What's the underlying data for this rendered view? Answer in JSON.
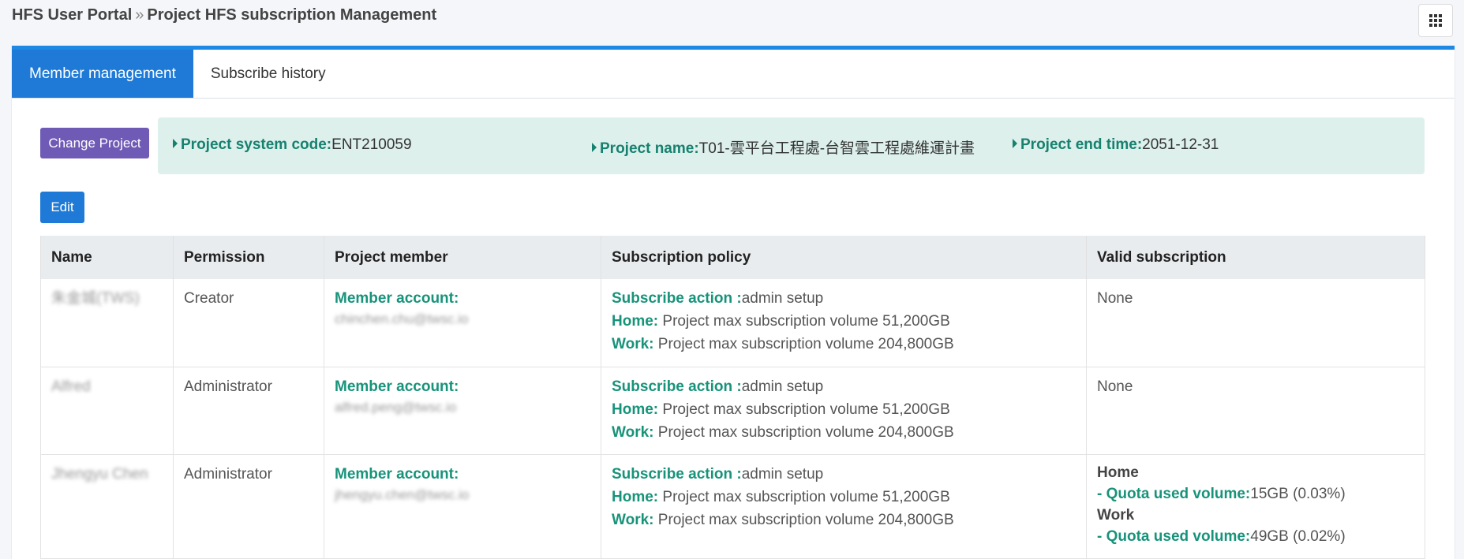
{
  "breadcrumb": {
    "root": "HFS User Portal",
    "separator": "»",
    "current": "Project HFS subscription Management"
  },
  "apps_icon": "apps-grid-icon",
  "tabs": [
    {
      "label": "Member management",
      "active": true
    },
    {
      "label": "Subscribe history",
      "active": false
    }
  ],
  "buttons": {
    "change_project": "Change Project",
    "edit": "Edit"
  },
  "project_info": {
    "code_label": "Project system code:",
    "code_value": "ENT210059",
    "name_label": "Project name:",
    "name_value": "T01-雲平台工程處-台智雲工程處維運計畫",
    "end_label": "Project end time:",
    "end_value": "2051-12-31"
  },
  "table": {
    "headers": [
      "Name",
      "Permission",
      "Project member",
      "Subscription policy",
      "Valid subscription"
    ],
    "labels": {
      "member_account": "Member account:",
      "subscribe_action": "Subscribe action :",
      "home": "Home:",
      "work": "Work:",
      "quota": " - Quota used volume:"
    },
    "rows": [
      {
        "name": "朱金城(TWS)",
        "permission": "Creator",
        "account": "chinchen.chu@twsc.io",
        "subscribe_action": "admin setup",
        "home_policy": "Project max subscription volume 51,200GB",
        "work_policy": "Project max subscription volume 204,800GB",
        "valid": "None"
      },
      {
        "name": "Alfred",
        "permission": "Administrator",
        "account": "alfred.peng@twsc.io",
        "subscribe_action": "admin setup",
        "home_policy": "Project max subscription volume 51,200GB",
        "work_policy": "Project max subscription volume 204,800GB",
        "valid": "None"
      },
      {
        "name": "Jhengyu Chen",
        "permission": "Administrator",
        "account": "jhengyu.chen@twsc.io",
        "subscribe_action": "admin setup",
        "home_policy": "Project max subscription volume 51,200GB",
        "work_policy": "Project max subscription volume 204,800GB",
        "valid_home_title": "Home",
        "valid_home_value": "15GB (0.03%)",
        "valid_work_title": "Work",
        "valid_work_value": "49GB (0.02%)"
      }
    ]
  },
  "colors": {
    "accent": "#1e7ad6",
    "purple": "#6f5ab5",
    "teal": "#17937a",
    "info_bg": "#ddf0ec"
  }
}
